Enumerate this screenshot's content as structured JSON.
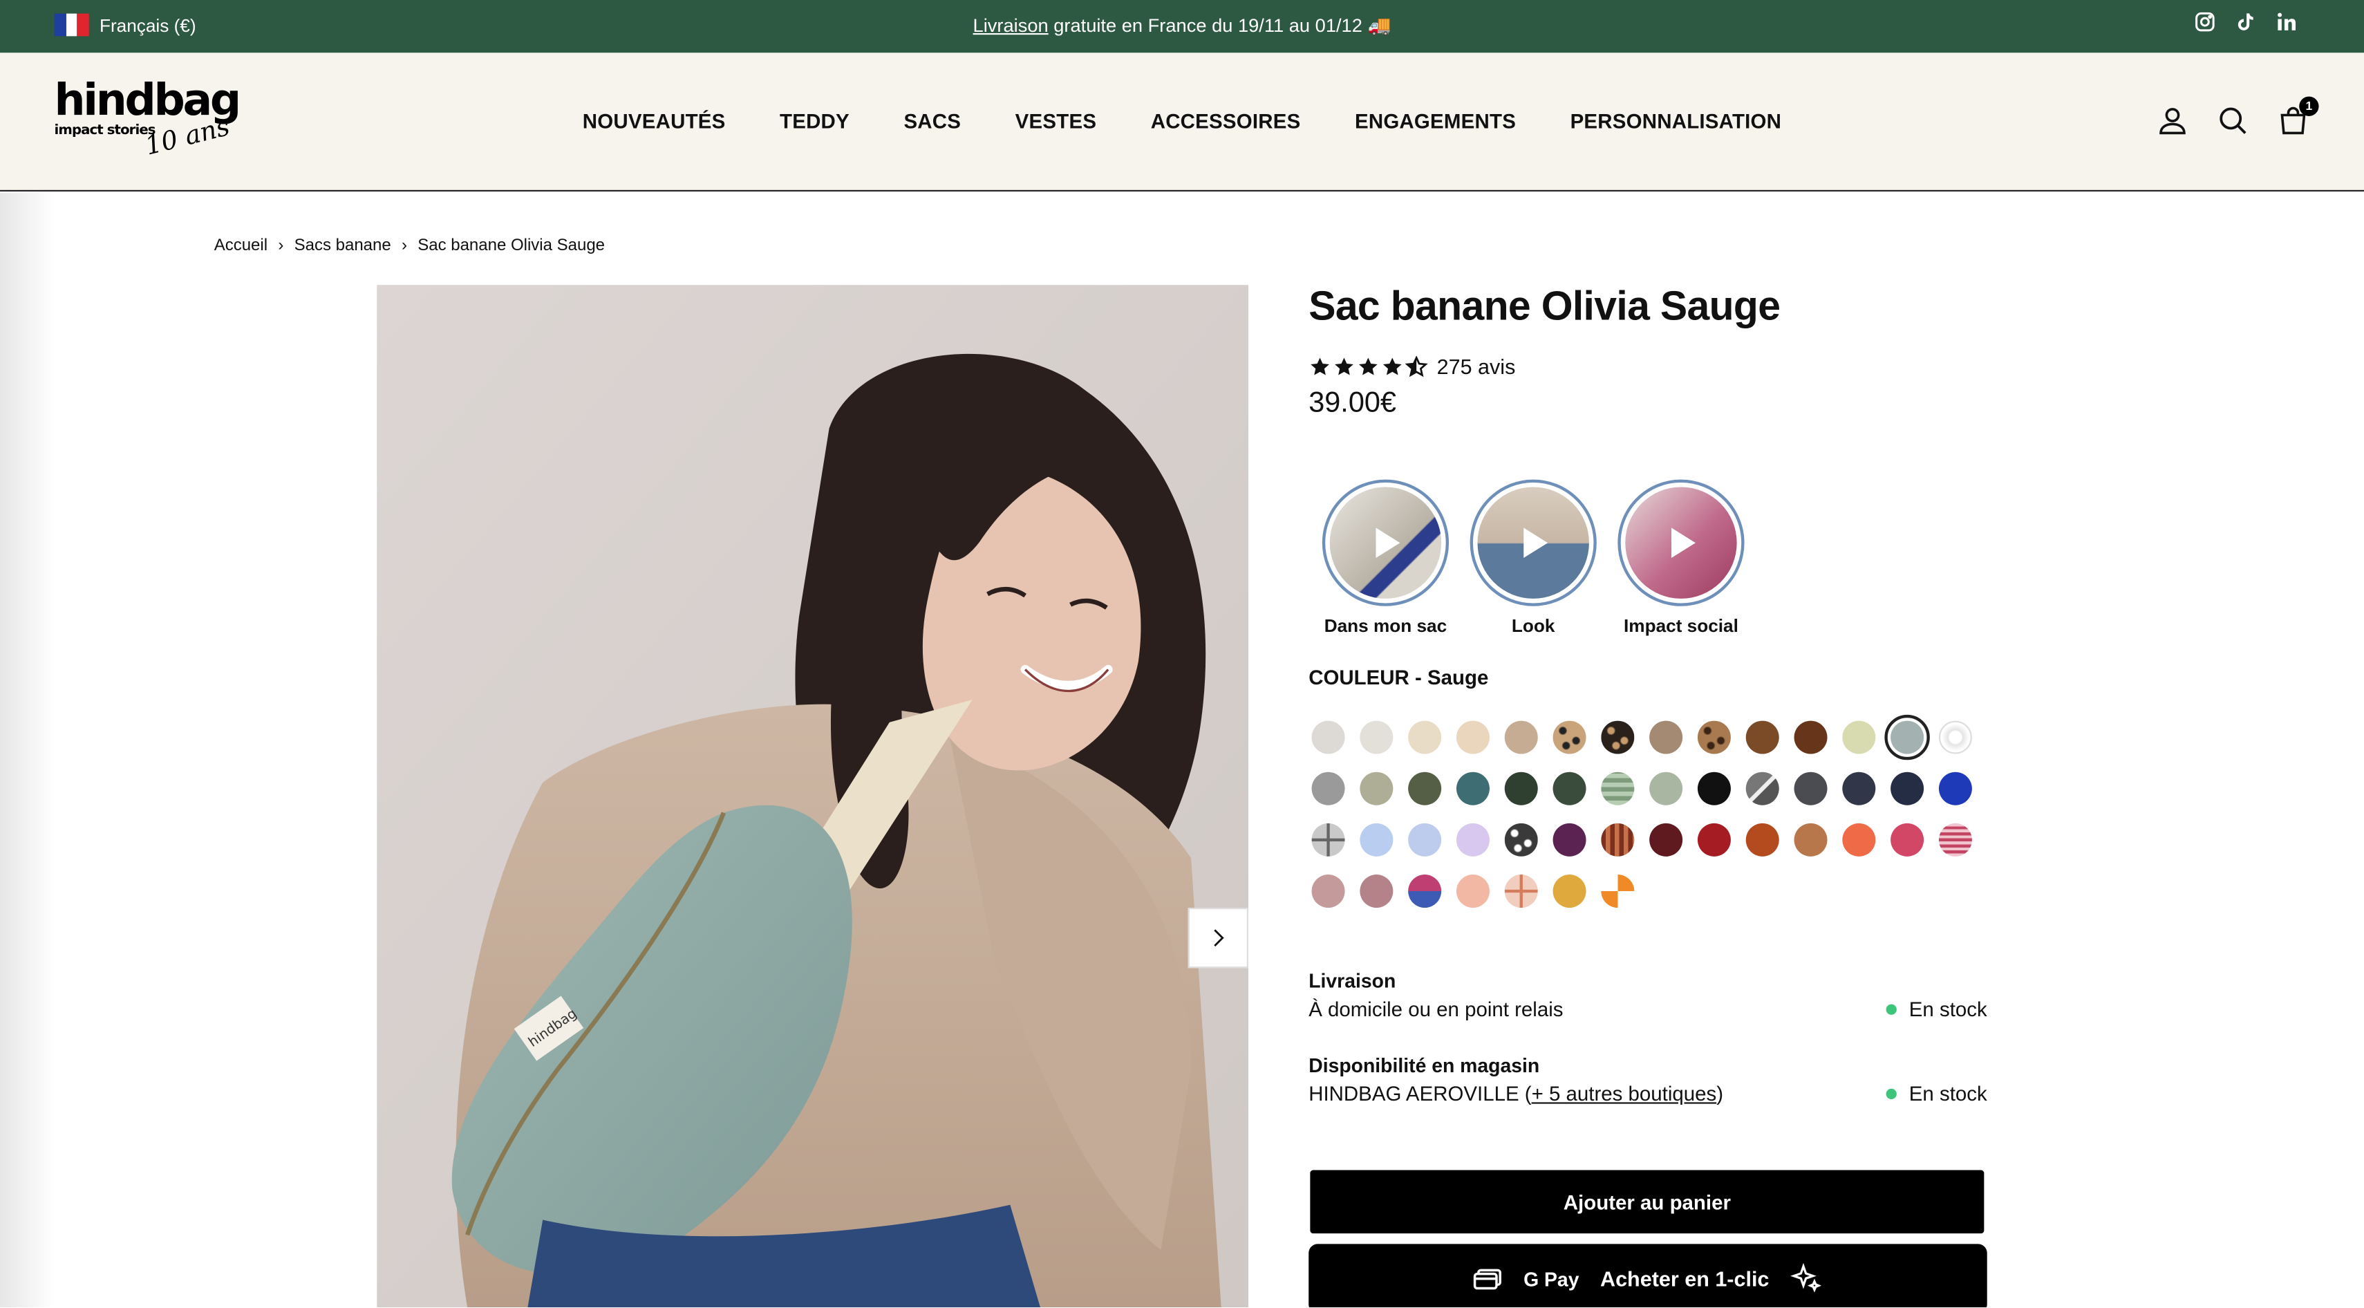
{
  "topbar": {
    "language": "Français (€)",
    "announcement_link": "Livraison",
    "announcement_rest": " gratuite en France du 19/11 au 01/12 🚚",
    "socials": [
      "instagram-icon",
      "tiktok-icon",
      "linkedin-icon"
    ],
    "bg_color": "#2d5842"
  },
  "header": {
    "logo_main": "hindbag",
    "logo_sub": "impact stories",
    "logo_anniv": "10 ans",
    "nav": [
      "NOUVEAUTÉS",
      "TEDDY",
      "SACS",
      "VESTES",
      "ACCESSOIRES",
      "ENGAGEMENTS",
      "PERSONNALISATION"
    ],
    "cart_count": "1"
  },
  "breadcrumb": [
    "Accueil",
    "Sacs banane",
    "Sac banane Olivia Sauge"
  ],
  "product": {
    "title": "Sac banane Olivia Sauge",
    "rating": 4.5,
    "reviews": "275 avis",
    "price": "39.00€",
    "stories": [
      {
        "label": "Dans mon sac"
      },
      {
        "label": "Look"
      },
      {
        "label": "Impact social"
      }
    ],
    "color_label": "COULEUR - Sauge",
    "swatches": [
      "#dddad6",
      "#e3e0da",
      "#e8dcc6",
      "#ead5bd",
      "#c7ac94",
      "leopard",
      "leopard-dark",
      "#a48a73",
      "leopard-brown",
      "#7b4a27",
      "#66351a",
      "#d8dbb0",
      "#a3b1b1",
      "logo",
      "#9a9a9a",
      "#aeae97",
      "#555f45",
      "#3e6e74",
      "#2f3f30",
      "#3a4c3c",
      "check-green",
      "#a8b6a2",
      "#111111",
      "slash-gray",
      "#4a4c52",
      "#313649",
      "#252d45",
      "#1f3ab8",
      "cross-gray",
      "#b9cdf0",
      "#bdccec",
      "#d8c7ee",
      "leopard-bw",
      "#5a2352",
      "check-brown",
      "#5e1a1f",
      "#a61c23",
      "#b34b1e",
      "#b8774a",
      "#ef6b48",
      "#d14765",
      "check-pink",
      "#c49a9a",
      "#b4838a",
      "stripe-blue-pink",
      "#f2b8a4",
      "cross-peach",
      "#e0a93e",
      "ball-orange"
    ],
    "selected_swatch": 12,
    "delivery_title": "Livraison",
    "delivery_text": "À domicile ou en point relais",
    "delivery_stock": "En stock",
    "store_title": "Disponibilité en magasin",
    "store_text_a": "HINDBAG AEROVILLE (",
    "store_link": "+ 5 autres boutiques",
    "store_text_b": ")",
    "store_stock": "En stock",
    "add_to_cart": "Ajouter au panier",
    "gpay": "G Pay",
    "one_click": "Acheter en 1-clic"
  }
}
